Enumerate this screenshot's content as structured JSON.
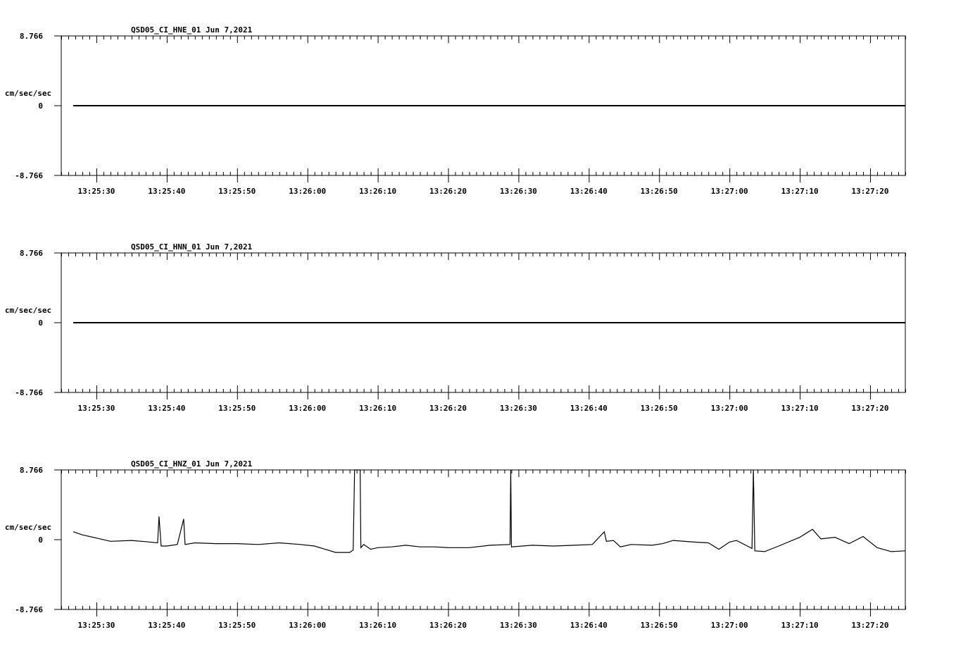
{
  "chart_data": [
    {
      "type": "line",
      "title": "QSD05_CI_HNE_01  Jun 7,2021",
      "ylabel": "cm/sec/sec",
      "ylim": [
        -8.766,
        8.766
      ],
      "yticks": [
        "8.766",
        "0",
        "-8.766"
      ],
      "xlim": [
        "13:25:25",
        "13:27:25"
      ],
      "xticks": [
        "13:25:30",
        "13:25:40",
        "13:25:50",
        "13:26:00",
        "13:26:10",
        "13:26:20",
        "13:26:30",
        "13:26:40",
        "13:26:50",
        "13:27:00",
        "13:27:10",
        "13:27:20"
      ],
      "series": [
        {
          "x_start": "13:25:26.7",
          "x_end": "13:27:25",
          "values": [
            0,
            0
          ]
        }
      ]
    },
    {
      "type": "line",
      "title": "QSD05_CI_HNN_01  Jun 7,2021",
      "ylabel": "cm/sec/sec",
      "ylim": [
        -8.766,
        8.766
      ],
      "yticks": [
        "8.766",
        "0",
        "-8.766"
      ],
      "xlim": [
        "13:25:25",
        "13:27:25"
      ],
      "xticks": [
        "13:25:30",
        "13:25:40",
        "13:25:50",
        "13:26:00",
        "13:26:10",
        "13:26:20",
        "13:26:30",
        "13:26:40",
        "13:26:50",
        "13:27:00",
        "13:27:10",
        "13:27:20"
      ],
      "series": [
        {
          "x_start": "13:25:26.7",
          "x_end": "13:27:25",
          "values": [
            0,
            0
          ]
        }
      ]
    },
    {
      "type": "line",
      "title": "QSD05_CI_HNZ_01  Jun 7,2021",
      "ylabel": "cm/sec/sec",
      "ylim": [
        -8.766,
        8.766
      ],
      "yticks": [
        "8.766",
        "0",
        "-8.766"
      ],
      "xlim": [
        "13:25:25",
        "13:27:25"
      ],
      "xticks": [
        "13:25:30",
        "13:25:40",
        "13:25:50",
        "13:26:00",
        "13:26:10",
        "13:26:20",
        "13:26:30",
        "13:26:40",
        "13:26:50",
        "13:27:00",
        "13:27:10",
        "13:27:20"
      ],
      "series": [
        {
          "x": [
            "13:25:26.7",
            "13:25:28",
            "13:25:30",
            "13:25:32",
            "13:25:35",
            "13:25:37",
            "13:25:38.7",
            "13:25:38.9",
            "13:25:39.2",
            "13:25:40",
            "13:25:41.5",
            "13:25:42.4",
            "13:25:42.6",
            "13:25:44",
            "13:25:47",
            "13:25:50",
            "13:25:53",
            "13:25:56",
            "13:25:59",
            "13:26:01",
            "13:26:02.5",
            "13:26:04",
            "13:26:06",
            "13:26:06.5",
            "13:26:06.7",
            "13:26:06.8",
            "13:26:07.5",
            "13:26:07.6",
            "13:26:08",
            "13:26:09",
            "13:26:10",
            "13:26:12",
            "13:26:14",
            "13:26:16",
            "13:26:18",
            "13:26:20",
            "13:26:23",
            "13:26:26",
            "13:26:28.8",
            "13:26:28.9",
            "13:26:29",
            "13:26:32",
            "13:26:35",
            "13:26:38",
            "13:26:40.5",
            "13:26:42.2",
            "13:26:42.5",
            "13:26:43.5",
            "13:26:44.5",
            "13:26:46",
            "13:26:49",
            "13:26:50.5",
            "13:26:52",
            "13:26:55",
            "13:26:57",
            "13:26:58.5",
            "13:27:00",
            "13:27:01",
            "13:27:03.2",
            "13:27:03.4",
            "13:27:03.6",
            "13:27:05",
            "13:27:07",
            "13:27:10",
            "13:27:11.8",
            "13:27:13",
            "13:27:15",
            "13:27:17",
            "13:27:19",
            "13:27:21",
            "13:27:23",
            "13:27:25"
          ],
          "values": [
            1.0,
            0.6,
            0.2,
            -0.2,
            -0.1,
            -0.25,
            -0.4,
            2.9,
            -0.8,
            -0.8,
            -0.6,
            2.6,
            -0.6,
            -0.4,
            -0.5,
            -0.5,
            -0.6,
            -0.4,
            -0.6,
            -0.8,
            -1.2,
            -1.6,
            -1.6,
            -1.3,
            8.766,
            8.766,
            8.766,
            -1.0,
            -0.6,
            -1.2,
            -1.0,
            -0.9,
            -0.7,
            -0.9,
            -0.9,
            -1.0,
            -1.0,
            -0.7,
            -0.6,
            8.766,
            -0.9,
            -0.7,
            -0.8,
            -0.7,
            -0.6,
            1.0,
            -0.2,
            -0.1,
            -0.9,
            -0.6,
            -0.7,
            -0.5,
            -0.1,
            -0.3,
            -0.4,
            -1.2,
            -0.3,
            -0.1,
            -1.1,
            8.766,
            -1.4,
            -1.5,
            -0.8,
            0.3,
            1.3,
            0.1,
            0.3,
            -0.5,
            0.4,
            -1.0,
            -1.5,
            -1.4
          ]
        }
      ]
    }
  ]
}
